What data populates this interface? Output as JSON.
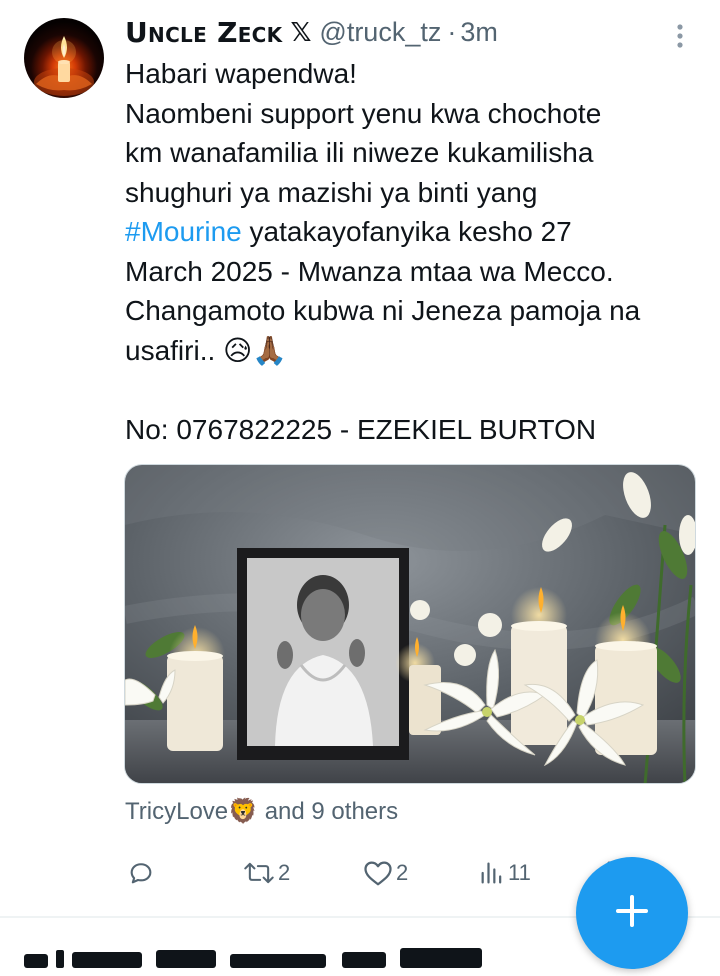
{
  "tweet": {
    "display_name": "Uncle Zeck",
    "verified_badge": "𝕏",
    "handle": "@truck_tz",
    "separator": "·",
    "time": "3m",
    "more_icon": "more-vertical-icon",
    "body": {
      "line1": "Habari wapendwa!",
      "line2": "Naombeni support yenu kwa chochote",
      "line3": "km wanafamilia ili niweze kukamilisha",
      "line4": "shughuri ya mazishi ya binti yang",
      "hashtag": "#Mourine",
      "line5_rest": " yatakayofanyika kesho 27",
      "line6": "March 2025 - Mwanza mtaa wa Mecco.",
      "line7": "Changamoto kubwa ni Jeneza pamoja na",
      "line8": "usafiri.. ",
      "emojis": "😥🙏🏾",
      "contact": "No: 0767822225 - EZEKIEL BURTON"
    },
    "media_alt": "memorial-photo-with-candles",
    "likers": {
      "name": "TricyLove",
      "emoji": "🦁",
      "rest": " and 9 others"
    },
    "actions": {
      "reply_icon": "reply-icon",
      "retweet_icon": "retweet-icon",
      "retweet_count": "2",
      "like_icon": "heart-icon",
      "like_count": "2",
      "views_icon": "views-icon",
      "views_count": "11",
      "share_icon": "share-icon"
    }
  },
  "fab": {
    "icon": "plus-icon"
  },
  "colors": {
    "accent": "#1d9bf0",
    "text": "#0f1419",
    "muted": "#536471"
  }
}
